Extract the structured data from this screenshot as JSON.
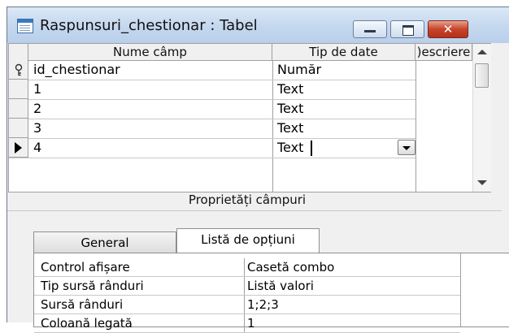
{
  "window": {
    "title": "Raspunsuri_chestionar : Tabel",
    "icon": "table-icon",
    "controls": {
      "minimize": "minimize-icon",
      "maximize": "maximize-icon",
      "close": "✕"
    }
  },
  "grid": {
    "headers": [
      "Nume câmp",
      "Tip de date",
      ")escriere"
    ],
    "rows": [
      {
        "name": "id_chestionar",
        "type": "Număr",
        "selector": "key-icon"
      },
      {
        "name": "1",
        "type": "Text",
        "selector": ""
      },
      {
        "name": "2",
        "type": "Text",
        "selector": ""
      },
      {
        "name": "3",
        "type": "Text",
        "selector": ""
      },
      {
        "name": "4",
        "type": "Text",
        "selector": "current-row-arrow-icon"
      }
    ]
  },
  "properties": {
    "section_title": "Proprietăți câmpuri",
    "tabs": [
      "General",
      "Listă de opțiuni"
    ],
    "active_tab": "Listă de opțiuni",
    "rows": [
      {
        "label": "Control afișare",
        "value": "Casetă combo"
      },
      {
        "label": "Tip sursă rânduri",
        "value": "Listă valori"
      },
      {
        "label": "Sursă rânduri",
        "value": "1;2;3"
      },
      {
        "label": "Coloană legată",
        "value": "1"
      }
    ]
  },
  "colors": {
    "titlebar": "#c4d7ee",
    "close_button": "#c6442b",
    "grid_lines": "#a0a0a0"
  }
}
